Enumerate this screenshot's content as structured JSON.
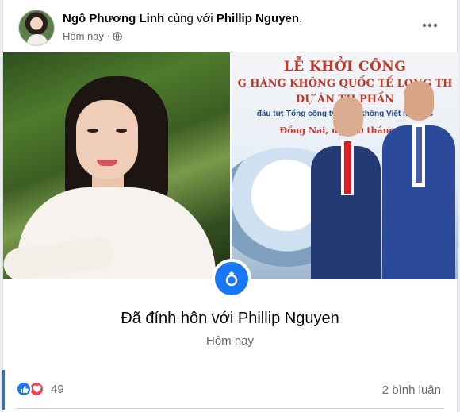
{
  "post": {
    "author": "Ngô Phương Linh",
    "with_word": "cùng với",
    "tagged": "Phillip Nguyen",
    "time": "Hôm nay",
    "privacy_icon": "globe-icon",
    "more_icon": "ellipsis-icon"
  },
  "photos": {
    "right_banner": {
      "line1": "LỄ KHỞI CÔNG",
      "line2": "G HÀNG KHÔNG QUỐC TẾ LONG TH",
      "line3": "DỰ ÁN TH    PHẦN",
      "line4": "đầu tư: Tổng công ty Cảng     không Việt    m - CTC",
      "line5": "Đồng Nai, ngày 0    tháng 01"
    }
  },
  "event": {
    "icon": "ring-icon",
    "title": "Đã đính hôn với Phillip Nguyen",
    "time": "Hôm nay"
  },
  "footer": {
    "reaction_count": "49",
    "comments": "2 bình luận"
  },
  "colors": {
    "accent": "#1877f2",
    "love": "#f33e58",
    "secondary_text": "#65676b"
  }
}
